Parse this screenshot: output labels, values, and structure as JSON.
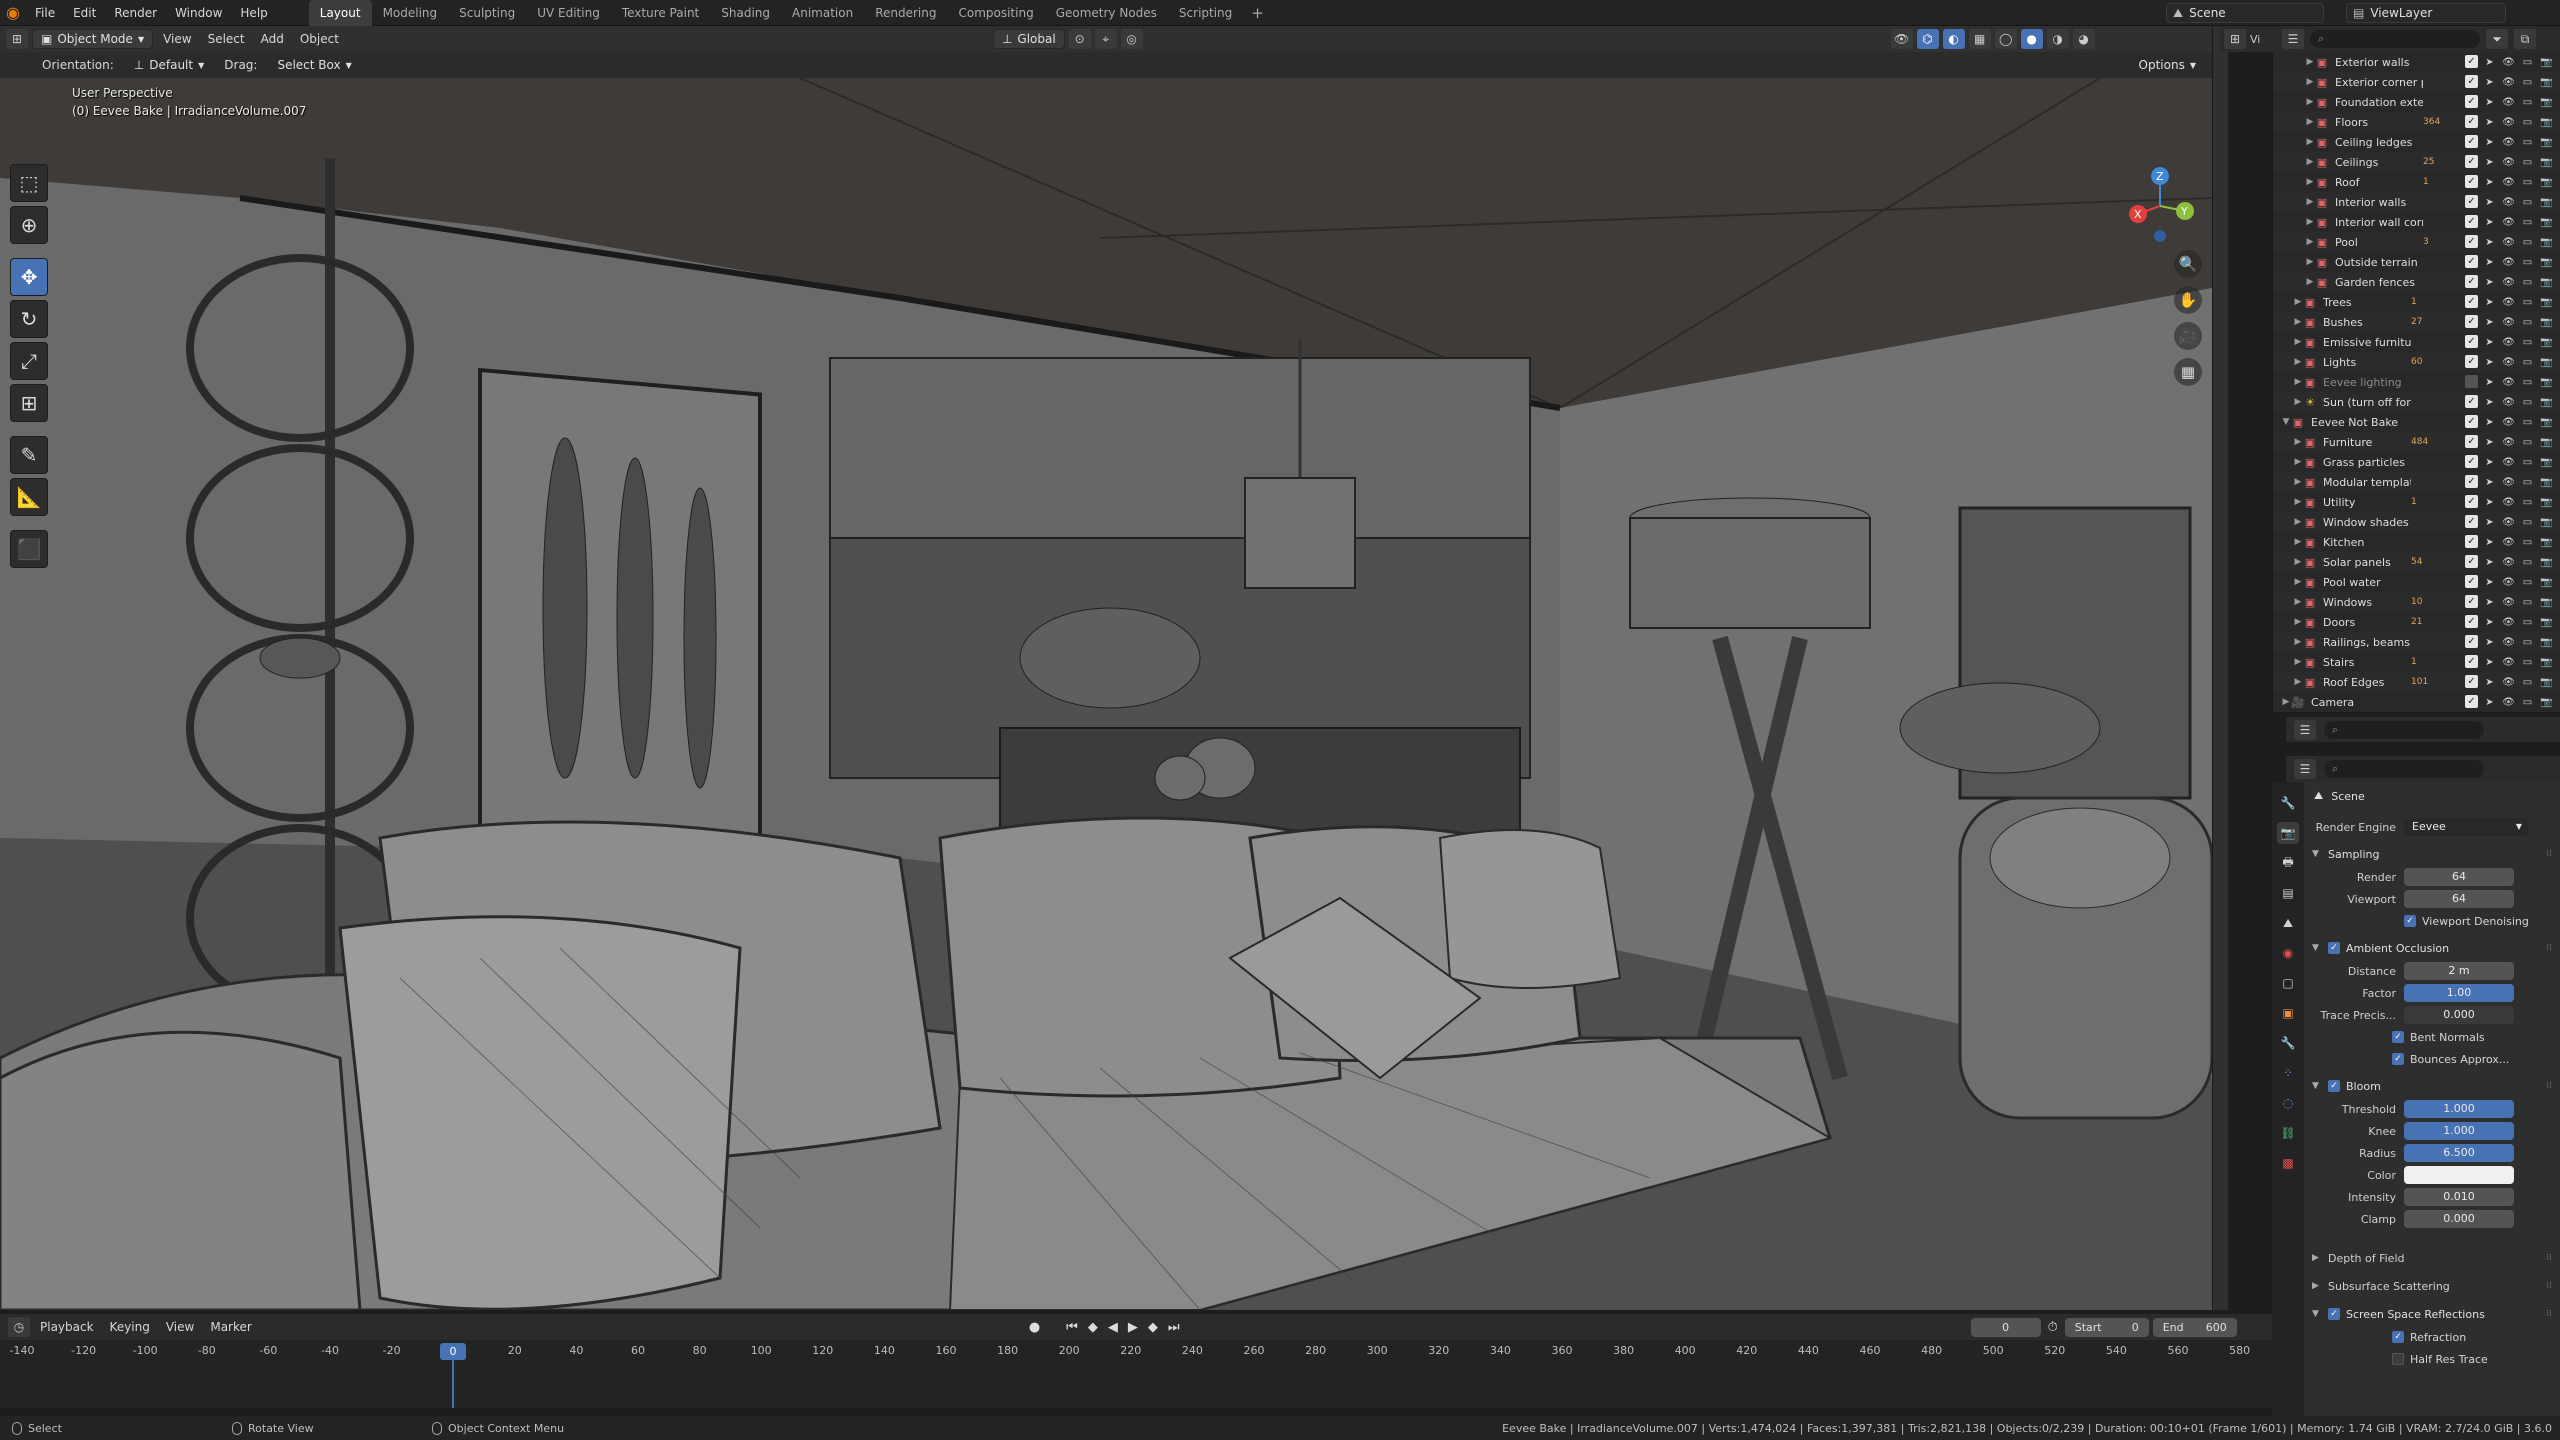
{
  "app": {
    "menus": [
      "File",
      "Edit",
      "Render",
      "Window",
      "Help"
    ],
    "workspaces": [
      "Layout",
      "Modeling",
      "Sculpting",
      "UV Editing",
      "Texture Paint",
      "Shading",
      "Animation",
      "Rendering",
      "Compositing",
      "Geometry Nodes",
      "Scripting"
    ],
    "active_workspace": "Layout",
    "add_tab": "+",
    "scene_name": "Scene",
    "view_layer": "ViewLayer"
  },
  "viewport_header": {
    "mode": "Object Mode",
    "menus": [
      "View",
      "Select",
      "Add",
      "Object"
    ],
    "transform_orientation": "Global",
    "orientation_label": "Orientation:",
    "orientation_value": "Default",
    "drag_label": "Drag:",
    "drag_value": "Select Box",
    "options": "Options"
  },
  "viewport": {
    "perspective": "User Perspective",
    "object_info": "(0) Eevee Bake | IrradianceVolume.007",
    "gizmo_axes": {
      "x": "X",
      "y": "Y",
      "z": "Z"
    },
    "colors": {
      "x": "#e2403c",
      "y": "#8bc13d",
      "z": "#3f87d9",
      "background": "#5b5b5b"
    }
  },
  "tools": [
    "select-box",
    "cursor",
    "move",
    "rotate",
    "scale",
    "transform",
    "annotate",
    "measure",
    "add-cube"
  ],
  "timeline": {
    "menus": [
      "Playback",
      "Keying",
      "View",
      "Marker"
    ],
    "current_frame": "0",
    "start_label": "Start",
    "start": "0",
    "end_label": "End",
    "end": "600",
    "ticks": [
      "-140",
      "-120",
      "-100",
      "-80",
      "-60",
      "-40",
      "-20",
      "0",
      "20",
      "40",
      "60",
      "80",
      "100",
      "120",
      "140",
      "160",
      "180",
      "200",
      "220",
      "240",
      "260",
      "280",
      "300",
      "320",
      "340",
      "360",
      "380",
      "400",
      "420",
      "440",
      "460",
      "480",
      "500",
      "520",
      "540",
      "560",
      "580"
    ],
    "cursor_label": "0"
  },
  "statusbar": {
    "select": "Select",
    "rotate": "Rotate View",
    "context": "Object Context Menu",
    "stats": "Eevee Bake | IrradianceVolume.007 | Verts:1,474,024 | Faces:1,397,381 | Tris:2,821,138 | Objects:0/2,239 | Duration: 00:10+01 (Frame 1/601) | Memory: 1.74 GiB | VRAM: 2.7/24.0 GiB | 3.6.0"
  },
  "outliner": {
    "rows": [
      {
        "label": "Exterior walls",
        "depth": 2,
        "badge": "",
        "dim": false
      },
      {
        "label": "Exterior corner p",
        "depth": 2,
        "badge": "",
        "dim": false
      },
      {
        "label": "Foundation exter",
        "depth": 2,
        "badge": "",
        "dim": false
      },
      {
        "label": "Floors",
        "depth": 2,
        "badge": "364",
        "dim": false
      },
      {
        "label": "Ceiling ledges",
        "depth": 2,
        "badge": "",
        "dim": false
      },
      {
        "label": "Ceilings",
        "depth": 2,
        "badge": "25",
        "dim": false
      },
      {
        "label": "Roof",
        "depth": 2,
        "badge": "1",
        "dim": false
      },
      {
        "label": "Interior walls",
        "depth": 2,
        "badge": "",
        "dim": false
      },
      {
        "label": "Interior wall corr",
        "depth": 2,
        "badge": "",
        "dim": false
      },
      {
        "label": "Pool",
        "depth": 2,
        "badge": "3",
        "dim": false
      },
      {
        "label": "Outside terrain",
        "depth": 2,
        "badge": "",
        "dim": false
      },
      {
        "label": "Garden fences",
        "depth": 2,
        "badge": "",
        "dim": false
      },
      {
        "label": "Trees",
        "depth": 1,
        "badge": "1",
        "dim": false
      },
      {
        "label": "Bushes",
        "depth": 1,
        "badge": "27",
        "dim": false
      },
      {
        "label": "Emissive furniture",
        "depth": 1,
        "badge": "",
        "dim": false
      },
      {
        "label": "Lights",
        "depth": 1,
        "badge": "60",
        "dim": false
      },
      {
        "label": "Eevee lighting",
        "depth": 1,
        "badge": "",
        "dim": true
      },
      {
        "label": "Sun (turn off for cycle",
        "depth": 1,
        "badge": "",
        "dim": false
      },
      {
        "label": "Eevee Not Bake",
        "depth": 0,
        "badge": "",
        "dim": false
      },
      {
        "label": "Furniture",
        "depth": 1,
        "badge": "484",
        "dim": false
      },
      {
        "label": "Grass particles",
        "depth": 1,
        "badge": "",
        "dim": false
      },
      {
        "label": "Modular template",
        "depth": 1,
        "badge": "",
        "dim": false
      },
      {
        "label": "Utility",
        "depth": 1,
        "badge": "1",
        "dim": false
      },
      {
        "label": "Window shades",
        "depth": 1,
        "badge": "",
        "dim": false
      },
      {
        "label": "Kitchen",
        "depth": 1,
        "badge": "",
        "dim": false
      },
      {
        "label": "Solar panels",
        "depth": 1,
        "badge": "54",
        "dim": false
      },
      {
        "label": "Pool water",
        "depth": 1,
        "badge": "",
        "dim": false
      },
      {
        "label": "Windows",
        "depth": 1,
        "badge": "10",
        "dim": false
      },
      {
        "label": "Doors",
        "depth": 1,
        "badge": "21",
        "dim": false
      },
      {
        "label": "Railings, beams and",
        "depth": 1,
        "badge": "",
        "dim": false
      },
      {
        "label": "Stairs",
        "depth": 1,
        "badge": "1",
        "dim": false
      },
      {
        "label": "Roof Edges",
        "depth": 1,
        "badge": "101",
        "dim": false
      },
      {
        "label": "Camera",
        "depth": 0,
        "badge": "",
        "dim": false
      }
    ]
  },
  "properties": {
    "scene": "Scene",
    "render_engine_label": "Render Engine",
    "render_engine": "Eevee",
    "sampling": {
      "title": "Sampling",
      "render_label": "Render",
      "render": "64",
      "viewport_label": "Viewport",
      "viewport": "64",
      "denoise": "Viewport Denoising"
    },
    "ao": {
      "title": "Ambient Occlusion",
      "distance_label": "Distance",
      "distance": "2 m",
      "factor_label": "Factor",
      "factor": "1.00",
      "trace_label": "Trace Precis...",
      "trace": "0.000",
      "bent": "Bent Normals",
      "bounces": "Bounces Approx..."
    },
    "bloom": {
      "title": "Bloom",
      "threshold_label": "Threshold",
      "threshold": "1.000",
      "knee_label": "Knee",
      "knee": "1.000",
      "radius_label": "Radius",
      "radius": "6.500",
      "color_label": "Color",
      "intensity_label": "Intensity",
      "intensity": "0.010",
      "clamp_label": "Clamp",
      "clamp": "0.000"
    },
    "dof": "Depth of Field",
    "sss": "Subsurface Scattering",
    "ssr": {
      "title": "Screen Space Reflections",
      "refraction": "Refraction",
      "half_res": "Half Res Trace"
    }
  }
}
